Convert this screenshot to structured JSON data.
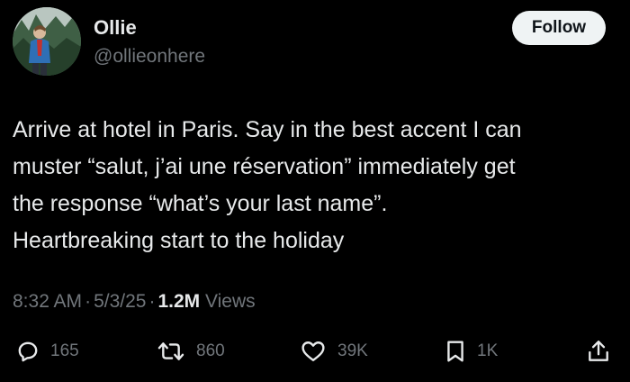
{
  "author": {
    "display_name": "Ollie",
    "handle": "@ollieonhere",
    "avatar_icon": "profile-photo-person-in-forest"
  },
  "follow_label": "Follow",
  "tweet": {
    "lines": [
      "Arrive at hotel in Paris. Say in the best accent I can",
      "muster “salut, j’ai une réservation” immediately get",
      "the response “what’s your last name”.",
      "Heartbreaking start to the holiday"
    ]
  },
  "meta": {
    "time": "8:32 AM",
    "dot1": "·",
    "date": "5/3/25",
    "dot2": "·",
    "views_count": "1.2M",
    "views_label": "Views"
  },
  "actions": {
    "reply": {
      "icon": "reply-icon",
      "count": "165"
    },
    "retweet": {
      "icon": "retweet-icon",
      "count": "860"
    },
    "like": {
      "icon": "heart-icon",
      "count": "39K"
    },
    "bookmark": {
      "icon": "bookmark-icon",
      "count": "1K"
    },
    "share": {
      "icon": "share-icon"
    }
  },
  "colors": {
    "background": "#000000",
    "text_primary": "#e7e9ea",
    "text_secondary": "#71767b",
    "follow_bg": "#eff3f4"
  }
}
